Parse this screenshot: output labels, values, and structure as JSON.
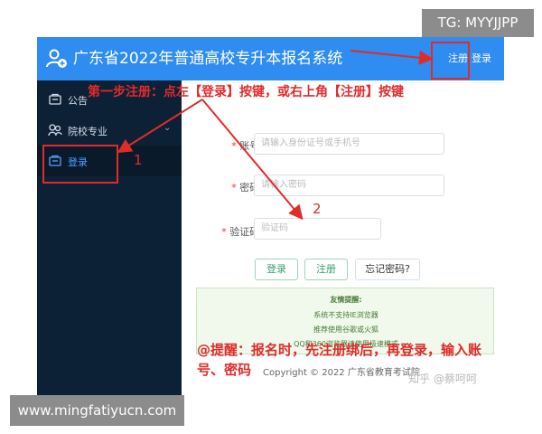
{
  "overlay_tags": {
    "tg": "TG: MYYJJPP",
    "site": "www.mingfatiyucn.com"
  },
  "header": {
    "title": "广东省2022年普通高校专升本报名系统",
    "register_link": "注册",
    "login_link": "登录",
    "logo_icon": "user-plus-icon"
  },
  "sidebar": {
    "items": [
      {
        "label": "公告",
        "icon": "announcement-icon",
        "active": false
      },
      {
        "label": "院校专业",
        "icon": "school-icon",
        "active": false,
        "has_chevron": true
      },
      {
        "label": "登录",
        "icon": "login-icon",
        "active": true
      }
    ]
  },
  "form": {
    "account": {
      "label": "账号:",
      "required": "*",
      "placeholder": "请输入身份证号或手机号"
    },
    "password": {
      "label": "密码:",
      "required": "*",
      "placeholder": "请输入密码"
    },
    "captcha": {
      "label": "验证码:",
      "required": "*",
      "placeholder": "验证码"
    },
    "buttons": {
      "login": "登录",
      "register": "注册",
      "forgot": "忘记密码?"
    }
  },
  "notice": {
    "title": "友情提醒:",
    "lines": [
      "系统不支持IE浏览器",
      "推荐使用谷歌或火狐",
      "QQ和360浏览器请使用极速模式"
    ]
  },
  "footer": {
    "copyright": "Copyright © 2022 广东省教育考试院"
  },
  "annotations": {
    "step_one": "第一步注册：点左【登录】按键，或右上角【注册】按键",
    "num1": "1",
    "num2": "2",
    "reminder_line1": "@提醒：报名时，先注册绑后，再登录，输入账",
    "reminder_line2": "号、密码"
  },
  "watermark": "知乎 @蔡呵呵",
  "colors": {
    "header_blue": "#2f8cf0",
    "sidebar_dark": "#0d2136",
    "annotation_red": "#e12b2b",
    "button_green": "#3a9b71",
    "notice_bg": "#f0f9eb"
  }
}
